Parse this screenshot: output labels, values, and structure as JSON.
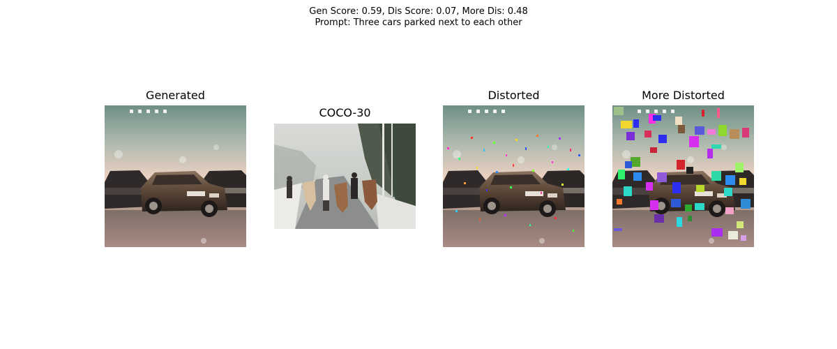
{
  "figure": {
    "suptitle_line1": "Gen Score: 0.59, Dis Score: 0.07, More Dis: 0.48",
    "suptitle_line2": "Prompt: Three cars parked next to each other"
  },
  "panels": [
    {
      "title": "Generated"
    },
    {
      "title": "COCO-30"
    },
    {
      "title": "Distorted"
    },
    {
      "title": "More Distorted"
    }
  ]
}
